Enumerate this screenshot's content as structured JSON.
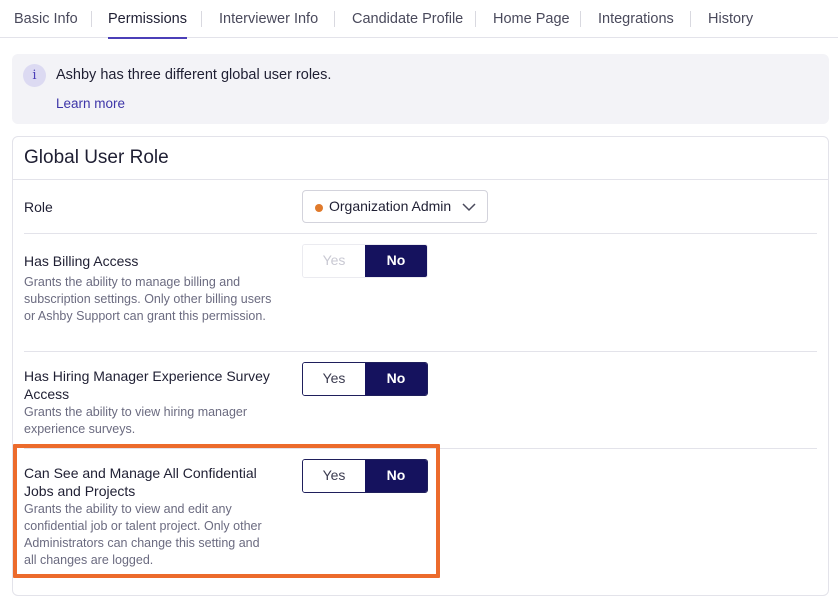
{
  "tabs": [
    {
      "label": "Basic Info",
      "active": false
    },
    {
      "label": "Permissions",
      "active": true
    },
    {
      "label": "Interviewer Info",
      "active": false
    },
    {
      "label": "Candidate Profile",
      "active": false
    },
    {
      "label": "Home Page",
      "active": false
    },
    {
      "label": "Integrations",
      "active": false
    },
    {
      "label": "History",
      "active": false
    }
  ],
  "callout": {
    "icon": "info-icon",
    "icon_glyph": "i",
    "text": "Ashby has three different global user roles.",
    "link": "Learn more"
  },
  "panel": {
    "title": "Global User Role",
    "role": {
      "label": "Role",
      "value": "Organization Admin",
      "dot_color": "#e07a2b"
    },
    "permissions": [
      {
        "label": "Has Billing Access",
        "description": "Grants the ability to manage billing and subscription settings. Only other billing users or Ashby Support can grant this permission.",
        "yes_label": "Yes",
        "no_label": "No",
        "selected": "No",
        "disabled": true
      },
      {
        "label": "Has Hiring Manager Experience Survey Access",
        "description": "Grants the ability to view hiring manager experience surveys.",
        "yes_label": "Yes",
        "no_label": "No",
        "selected": "No",
        "disabled": false
      },
      {
        "label": "Can See and Manage All Confidential Jobs and Projects",
        "description": "Grants the ability to view and edit any confidential job or talent project. Only other Administrators can change this setting and all changes are logged.",
        "yes_label": "Yes",
        "no_label": "No",
        "selected": "No",
        "disabled": false
      }
    ]
  },
  "colors": {
    "accent": "#4b3fb8",
    "toggle_selected": "#15125e",
    "highlight": "#ec6b2c"
  }
}
